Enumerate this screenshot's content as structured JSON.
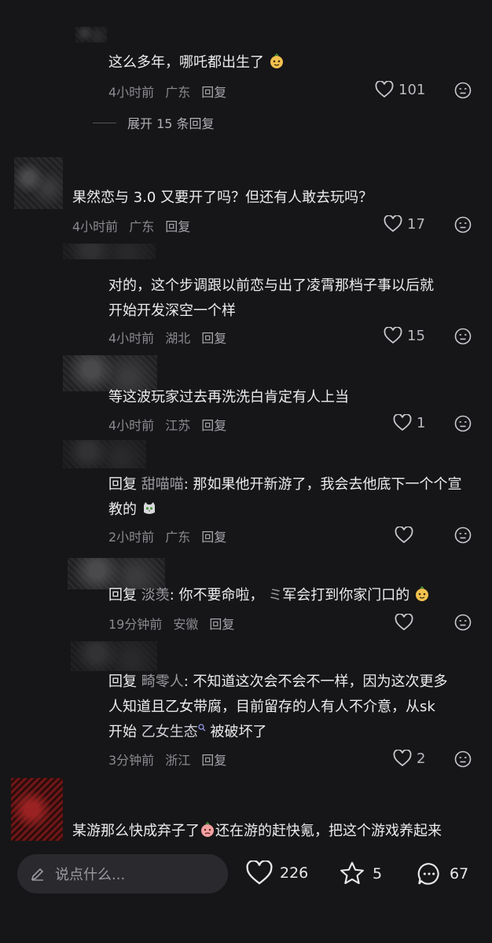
{
  "comments": [
    {
      "text": "这么多年，哪吒都出生了",
      "time": "4小时前",
      "location": "广东",
      "reply": "回复",
      "likes": "101"
    },
    {
      "expand": "展开 15 条回复"
    },
    {
      "text": "果然恋与 3.0 又要开了吗？但还有人敢去玩吗？",
      "time": "4小时前",
      "location": "广东",
      "reply": "回复",
      "likes": "17"
    },
    {
      "text_line1": "对的，这个步调跟以前恋与出了凌霄那档子事以后就",
      "text_line2": "开始开发深空一个样",
      "time": "4小时前",
      "location": "湖北",
      "reply": "回复",
      "likes": "15"
    },
    {
      "text": "等这波玩家过去再洗洗白肯定有人上当",
      "time": "4小时前",
      "location": "江苏",
      "reply": "回复",
      "likes": "1"
    },
    {
      "reply_prefix": "回复",
      "reply_to": "甜喵喵",
      "text_line1": ": 那如果他开新游了，我会去他底下一个个宣",
      "text_line2": "教的",
      "time": "2小时前",
      "location": "广东",
      "reply": "回复",
      "likes": ""
    },
    {
      "reply_prefix": "回复",
      "reply_to": "淡羡",
      "text": ": 你不要命啦，",
      "text_tail": "军会打到你家门口的",
      "time": "19分钟前",
      "location": "安徽",
      "reply": "回复",
      "likes": ""
    },
    {
      "reply_prefix": "回复",
      "reply_to": "畸零人",
      "text_line1": ": 不知道这次会不会不一样，因为这次更多",
      "text_line2": "人知道且乙女带腐，目前留存的人有人不介意，从sk",
      "text_line3_a": "开始",
      "text_line3_tag": "乙女生态",
      "text_line3_b": "被破坏了",
      "time": "3分钟前",
      "location": "浙江",
      "reply": "回复",
      "likes": "2"
    },
    {
      "text_a": "某游那么快成弃子了",
      "text_b": "还在游的赶快氪，把这个游戏养起来"
    }
  ],
  "bottom_bar": {
    "placeholder": "说点什么...",
    "likes": "226",
    "favorites": "5",
    "comments": "67"
  }
}
